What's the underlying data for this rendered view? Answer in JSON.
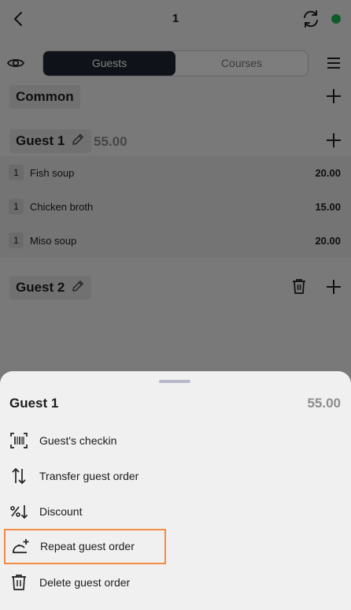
{
  "header": {
    "title": "1",
    "status_color": "#1db954"
  },
  "segmented": {
    "active": "Guests",
    "inactive": "Courses"
  },
  "common": {
    "label": "Common"
  },
  "guests": [
    {
      "name": "Guest 1",
      "total": "55.00",
      "items": [
        {
          "qty": "1",
          "name": "Fish soup",
          "price": "20.00"
        },
        {
          "qty": "1",
          "name": "Chicken broth",
          "price": "15.00"
        },
        {
          "qty": "1",
          "name": "Miso soup",
          "price": "20.00"
        }
      ]
    },
    {
      "name": "Guest 2"
    }
  ],
  "sheet": {
    "title": "Guest 1",
    "total": "55.00",
    "actions": [
      {
        "label": "Guest's checkin",
        "icon": "barcode-scan-icon"
      },
      {
        "label": "Transfer guest order",
        "icon": "transfer-arrows-icon"
      },
      {
        "label": "Discount",
        "icon": "percent-down-icon"
      },
      {
        "label": "Repeat guest order",
        "icon": "cloche-plus-icon",
        "highlight_color": "#f28b43"
      },
      {
        "label": "Delete guest order",
        "icon": "trash-icon"
      }
    ]
  }
}
